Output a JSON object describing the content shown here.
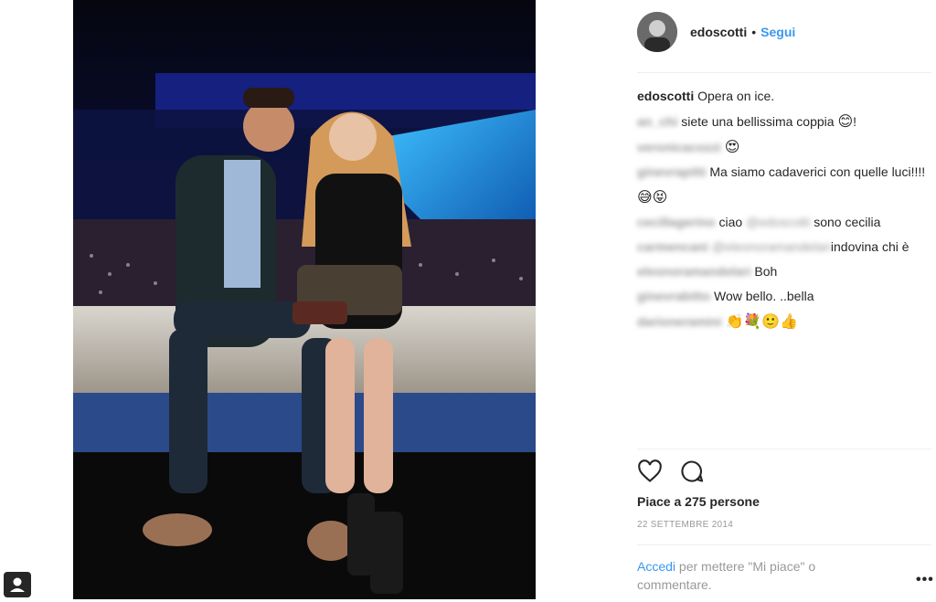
{
  "post": {
    "username": "edoscotti",
    "follow_label": "Segui",
    "separator": "•"
  },
  "comments": [
    {
      "user": "edoscotti",
      "user_blurred": false,
      "text": "Opera on ice.",
      "emoji": ""
    },
    {
      "user": "an_chi",
      "user_blurred": true,
      "text": "siete una bellissima coppia",
      "emoji": "😊",
      "suffix": "!"
    },
    {
      "user": "veronicacozzi",
      "user_blurred": true,
      "text": "",
      "emoji": "😍"
    },
    {
      "user": "ginevrapitti",
      "user_blurred": true,
      "text": "Ma siamo cadaverici con quelle luci!!!!",
      "emoji": "😅😝"
    },
    {
      "user": "cecillagerino",
      "user_blurred": true,
      "text": "ciao",
      "mention": "@edoscotti",
      "text2": "sono cecilia",
      "emoji": ""
    },
    {
      "user": "carmencani",
      "user_blurred": true,
      "text": "",
      "mention": "@eleonoramandelari",
      "text2": "indovina chi è",
      "emoji": ""
    },
    {
      "user": "eleonoramandelari",
      "user_blurred": true,
      "text": "Boh",
      "emoji": ""
    },
    {
      "user": "ginevrabitto",
      "user_blurred": true,
      "text": "Wow bello. ..bella",
      "emoji": ""
    },
    {
      "user": "darioneramini",
      "user_blurred": true,
      "text": "",
      "emoji": "👏💐🙂👍"
    }
  ],
  "likes_text": "Piace a 275 persone",
  "date_text": "22 SETTEMBRE 2014",
  "login": {
    "link": "Accedi",
    "rest": "per mettere \"Mi piace\" o commentare."
  },
  "more_label": "•••",
  "icons": [
    "heart-icon",
    "comment-icon",
    "user-tag-icon",
    "more-options-icon"
  ],
  "colors": {
    "link": "#3897f0",
    "text": "#262626",
    "muted": "#999999"
  }
}
